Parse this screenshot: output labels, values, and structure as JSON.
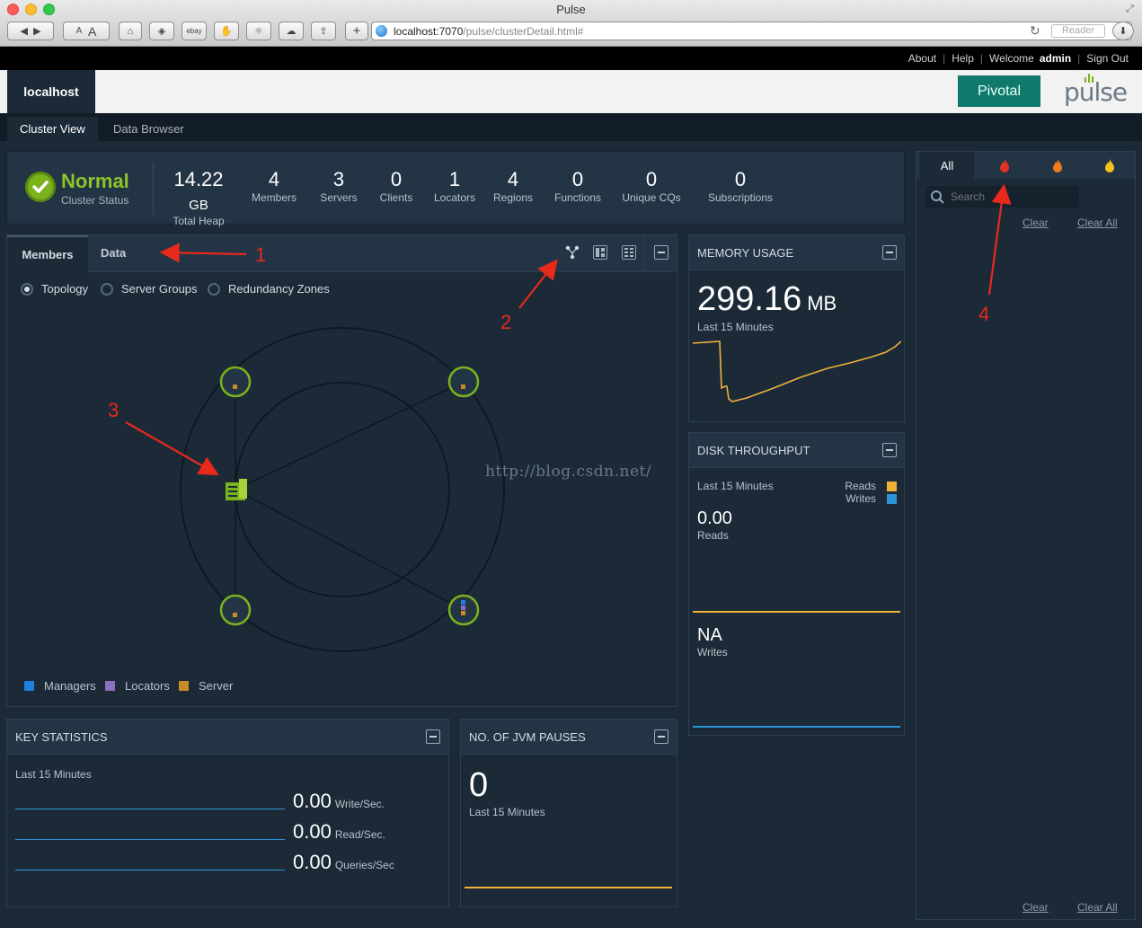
{
  "browser": {
    "window_title": "Pulse",
    "url_host": "localhost:7070",
    "url_path": "/pulse/clusterDetail.html#",
    "reader_label": "Reader",
    "buttons": {
      "text_small": "A",
      "text_large": "A",
      "ebay": "ebay",
      "add": "+"
    }
  },
  "topnav": {
    "about": "About",
    "help": "Help",
    "welcome": "Welcome",
    "user": "admin",
    "sign_out": "Sign Out"
  },
  "header": {
    "host": "localhost",
    "brand": "Pivotal",
    "product": "pulse"
  },
  "nav": {
    "cluster_view": "Cluster View",
    "data_browser": "Data Browser"
  },
  "status": {
    "state": "Normal",
    "state_label": "Cluster Status",
    "heap_value": "14.22",
    "heap_unit": "GB",
    "heap_label": "Total Heap",
    "stats": [
      {
        "value": "4",
        "label": "Members"
      },
      {
        "value": "3",
        "label": "Servers"
      },
      {
        "value": "0",
        "label": "Clients"
      },
      {
        "value": "1",
        "label": "Locators"
      },
      {
        "value": "4",
        "label": "Regions"
      },
      {
        "value": "0",
        "label": "Functions"
      },
      {
        "value": "0",
        "label": "Unique CQs"
      },
      {
        "value": "0",
        "label": "Subscriptions"
      }
    ]
  },
  "members": {
    "tab_members": "Members",
    "tab_data": "Data",
    "views": [
      "Topology",
      "Server Groups",
      "Redundancy Zones"
    ],
    "selected_view": "Topology",
    "legend": [
      {
        "label": "Managers",
        "color": "#1f7fe0"
      },
      {
        "label": "Locators",
        "color": "#8c6fbd"
      },
      {
        "label": "Server",
        "color": "#c98a2a"
      }
    ]
  },
  "memory": {
    "title": "MEMORY USAGE",
    "value": "299.16",
    "unit": "MB",
    "period": "Last 15 Minutes",
    "line_color": "#f0b13a"
  },
  "disk": {
    "title": "DISK THROUGHPUT",
    "period": "Last 15 Minutes",
    "legend_reads": "Reads",
    "legend_writes": "Writes",
    "reads_color": "#f0b13a",
    "writes_color": "#2b94d6",
    "reads_value": "0.00",
    "reads_label": "Reads",
    "writes_value": "NA",
    "writes_label": "Writes"
  },
  "key_stats": {
    "title": "KEY STATISTICS",
    "period": "Last 15 Minutes",
    "rows": [
      {
        "value": "0.00",
        "unit": "Write/Sec."
      },
      {
        "value": "0.00",
        "unit": "Read/Sec."
      },
      {
        "value": "0.00",
        "unit": "Queries/Sec"
      }
    ]
  },
  "jvm": {
    "title": "NO. OF JVM PAUSES",
    "value": "0",
    "period": "Last 15 Minutes"
  },
  "alerts": {
    "tab_all": "All",
    "search_placeholder": "Search",
    "clear": "Clear",
    "clear_all": "Clear All",
    "severity_colors": [
      "#e0341e",
      "#f07a1a",
      "#f5c21a"
    ]
  },
  "watermark": "http://blog.csdn.net/",
  "annotations": [
    "1",
    "2",
    "3",
    "4"
  ]
}
